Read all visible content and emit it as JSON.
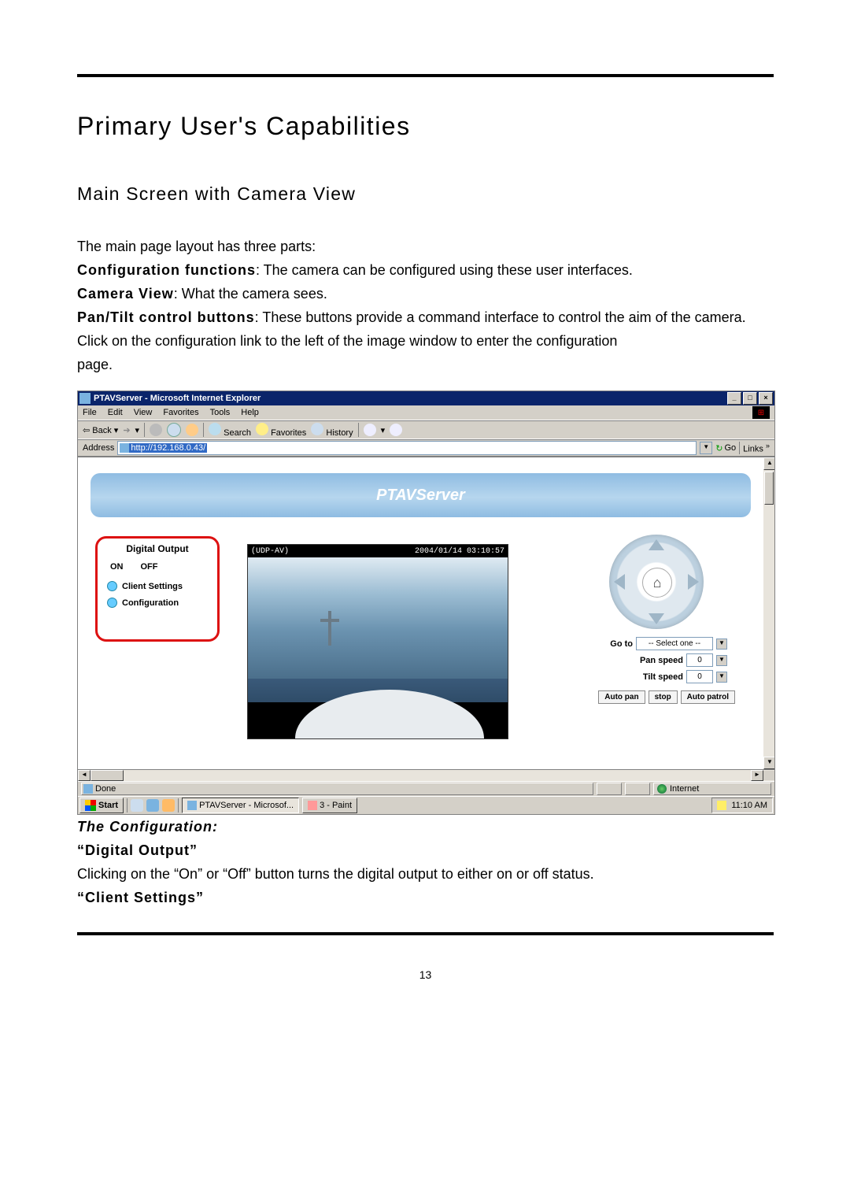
{
  "page_number": "13",
  "heading": "Primary User's Capabilities",
  "subheading": "Main Screen with Camera View",
  "intro_line": "The main page layout has three parts:",
  "parts": {
    "config_label": "Configuration functions",
    "config_text": ": The camera can be configured using these user interfaces.",
    "view_label": "Camera View",
    "view_text": ": What the camera sees.",
    "pantilt_label": "Pan/Tilt control buttons",
    "pantilt_text": ": These buttons provide a command interface to control the aim of the camera."
  },
  "click_note_1": "Click on the configuration link to the left of the image window to enter the configuration",
  "click_note_2": "page.",
  "ie": {
    "title": "PTAVServer - Microsoft Internet Explorer",
    "menus": [
      "File",
      "Edit",
      "View",
      "Favorites",
      "Tools",
      "Help"
    ],
    "toolbar": {
      "back": "Back",
      "search": "Search",
      "favorites": "Favorites",
      "history": "History"
    },
    "address_label": "Address",
    "address_url": "http://192.168.0.43/",
    "go": "Go",
    "links": "Links",
    "status_done": "Done",
    "status_zone": "Internet"
  },
  "taskbar": {
    "start": "Start",
    "task1": "PTAVServer - Microsof...",
    "task2": "3 - Paint",
    "clock": "11:10 AM"
  },
  "ptav": {
    "banner": "PTAVServer",
    "digital_output": "Digital Output",
    "on": "ON",
    "off": "OFF",
    "client_settings": "Client Settings",
    "configuration": "Configuration",
    "overlay_proto": "(UDP-AV)",
    "overlay_time": "2004/01/14 03:10:57",
    "goto": "Go to",
    "goto_value": "-- Select one --",
    "pan_speed": "Pan speed",
    "pan_value": "0",
    "tilt_speed": "Tilt speed",
    "tilt_value": "0",
    "auto_pan": "Auto pan",
    "stop": "stop",
    "auto_patrol": "Auto patrol"
  },
  "caption": {
    "heading": "The Configuration:",
    "digital_output_q": "“Digital Output”",
    "digital_output_desc": "Clicking on the “On” or “Off” button turns the digital output to either on or off status.",
    "client_settings_q": "“Client Settings”"
  }
}
